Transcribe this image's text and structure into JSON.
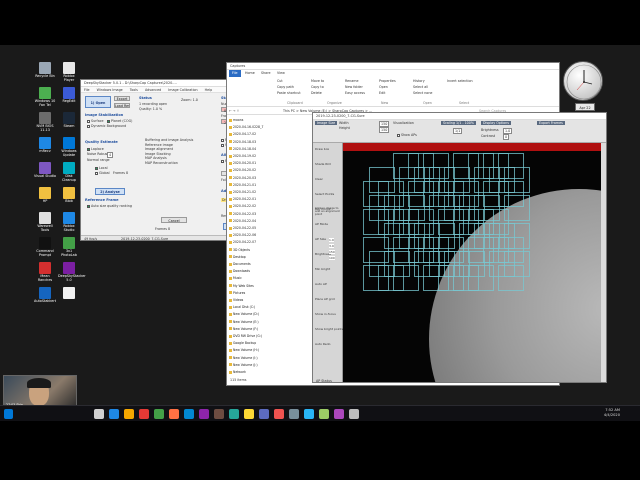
{
  "desktop": {
    "icons_left": [
      {
        "label": "Recycle Bin",
        "color": "#9aa7b5"
      },
      {
        "label": "Roblox Player",
        "color": "#e8e8e8"
      },
      {
        "label": "Windows 10 Fan Tel",
        "color": "#4caf50"
      },
      {
        "label": "RegEdit",
        "color": "#3b5bd6"
      },
      {
        "label": "NVM BIOS 11.13",
        "color": "#6c6c6c"
      },
      {
        "label": "Steam",
        "color": "#1b2838"
      },
      {
        "label": "mRecv",
        "color": "#1e88e5"
      },
      {
        "label": "Windows Update",
        "color": "#0078d7"
      },
      {
        "label": "Visual Studio",
        "color": "#7e57c2"
      },
      {
        "label": "Disk Cleanup",
        "color": "#00acc1"
      },
      {
        "label": "HP",
        "color": "#f0c040"
      },
      {
        "label": "Blob",
        "color": "#f0c040"
      },
      {
        "label": "Warewell Tools",
        "color": "#e0e0e0"
      },
      {
        "label": "Roblox Studio",
        "color": "#1e88e5"
      },
      {
        "label": "Command Prompt",
        "color": "#111111"
      },
      {
        "label": "3x1 PhotoLab",
        "color": "#43a047"
      },
      {
        "label": "Mean Ranches",
        "color": "#d32f2f"
      },
      {
        "label": "DeepSkyStacker 5.0",
        "color": "#7b1fa2"
      },
      {
        "label": "AutoStakkert",
        "color": "#1565c0"
      },
      {
        "label": "",
        "color": "#f0f0f0"
      }
    ],
    "clock_gadget": {
      "date": "Apr 22"
    }
  },
  "dss_window": {
    "title": "DeepSkyStacker 5.0.1 - D:\\SharpCap Captures\\2020-...",
    "menu": [
      "File",
      "Windows Image",
      "Tools",
      "Advanced",
      "Image Calibration",
      "Help"
    ],
    "open_button": "1) Open",
    "export_button": "Export",
    "load_button": "Load Results",
    "status_label": "Status",
    "status_lines": [
      "1 recording open",
      "Zoom: 1.0",
      "Quality: 1.0 %"
    ],
    "image_stabilization": "Image Stabilization",
    "stab_options": [
      "Surface",
      "Planet (COG)"
    ],
    "dynamic_background": "Dynamic Background",
    "quality_estimate": "Quality Estimate",
    "laplace": "Laplace",
    "noise_robust_label": "Noise Robust",
    "noise_robust_value": "4",
    "normal_range": "Normal range",
    "local": "Local",
    "global": "Global",
    "frames_label": "Frames 8",
    "analyse_button": "2) Analyse",
    "reference_frame": "Reference Frame",
    "auto_size": "Auto size quality ranking",
    "stack_options_title": "Stack Options",
    "num_frames_label": "Number of Frames to stack",
    "frame_pct_label": "Frame percentage to stack",
    "frame_values": [
      "80",
      "100",
      "20",
      "40"
    ],
    "normalize_stack": "Normalize Stack",
    "sharpened": "Sharpened",
    "steps": [
      "Buffering and image Analysis",
      "Reference image",
      "Image alignment",
      "Image Stacking",
      "MAP Analysis",
      "MAP Reconstruction"
    ],
    "ap_title": "Alignment Points",
    "ap_size_label": "AP Size",
    "ap_sizes": [
      "150",
      "200",
      "300"
    ],
    "ap_min_bright": "Min Bright",
    "place_aps": "Place AP grid",
    "clear_aps": "Clear",
    "stack_button": "3) Stack",
    "cancel_button": "Cancel",
    "advanced_settings": "Advanced Settings",
    "drizzle_label": "Drizzle",
    "drizzle_options": [
      "Off",
      "1.5 X",
      "3 X"
    ],
    "resample_label": "Resample",
    "resample_value": "1",
    "folder_label": "Folder Setup",
    "footer_left": "49 fps/s",
    "footer_mid": "2019-12-23-0200_7-CG-Sure",
    "footer_right": "Ready"
  },
  "explorer": {
    "title": "Captures",
    "tabs": [
      "File",
      "Home",
      "Share",
      "View"
    ],
    "address": "This PC > New Volume (E:) > SharpCap Captures > ...",
    "search_placeholder": "Search Captures",
    "ribbon_groups": [
      "Clipboard",
      "Organize",
      "New",
      "Open",
      "Select"
    ],
    "ribbon_items": [
      "Cut",
      "Copy path",
      "Paste shortcut",
      "Move to",
      "Copy to",
      "Delete",
      "Rename",
      "New folder",
      "Easy access",
      "Properties",
      "Open",
      "Edit",
      "History",
      "Select all",
      "Select none",
      "Invert selection"
    ],
    "tree": [
      "moons",
      "2020-04-16-0228_7",
      "2020-04-17-02",
      "2020-04-18-03",
      "2020-04-18-04",
      "2020-04-19-02",
      "2020-04-20-01",
      "2020-04-20-02",
      "2020-04-20-03",
      "2020-04-21-01",
      "2020-04-21-02",
      "2020-04-22-01",
      "2020-04-22-02",
      "2020-04-22-03",
      "2020-04-22-04",
      "2020-04-22-05",
      "2020-04-22-06",
      "2020-04-22-07",
      "3D Objects",
      "Desktop",
      "Documents",
      "Downloads",
      "Music",
      "My Web Sites",
      "Pictures",
      "Videos",
      "Local Disk (C:)",
      "New Volume (D:)",
      "New Volume (E:)",
      "New Volume (F:)",
      "DVD RW Drive (G:)",
      "Google Backup",
      "New Volume (H:)",
      "New Volume (I:)",
      "New Volume (J:)",
      "Network"
    ],
    "footer": "115 items"
  },
  "sharpcap": {
    "title": "2019-12-23-0200_7-CG-Sure",
    "toolbar": [
      "Image Size",
      "Width",
      "Height",
      "Visualization",
      "Scaling 1/1 - 100%",
      "Display Options",
      "Export Frames"
    ],
    "size_values": [
      "150",
      "150"
    ],
    "zoom_value": "1/1",
    "brightness_label": "Brightness",
    "brightness_value": "1.0",
    "contrast_label": "Contrast",
    "contrast_value": "0",
    "show_ap_label": "Show APs",
    "left_panel": [
      "Draw box",
      "Shade ROI",
      "Clear",
      "Select Points",
      "Rec Points",
      "AP Mode",
      "AP Size",
      "Brightness",
      "Min bright",
      "Auto AP",
      "Place AP grid",
      "Show in-focus",
      "Show bright points",
      "Auto Redo"
    ],
    "ap_side_values": [
      "1.9",
      "3.9",
      "150",
      "100"
    ],
    "click_hint": "Click in image to add an alignment point",
    "footer": "AP Status"
  },
  "taskbar": {
    "time": "7:52 AM",
    "date": "4/4/2020"
  },
  "webcam_label": "27:03  Skin"
}
